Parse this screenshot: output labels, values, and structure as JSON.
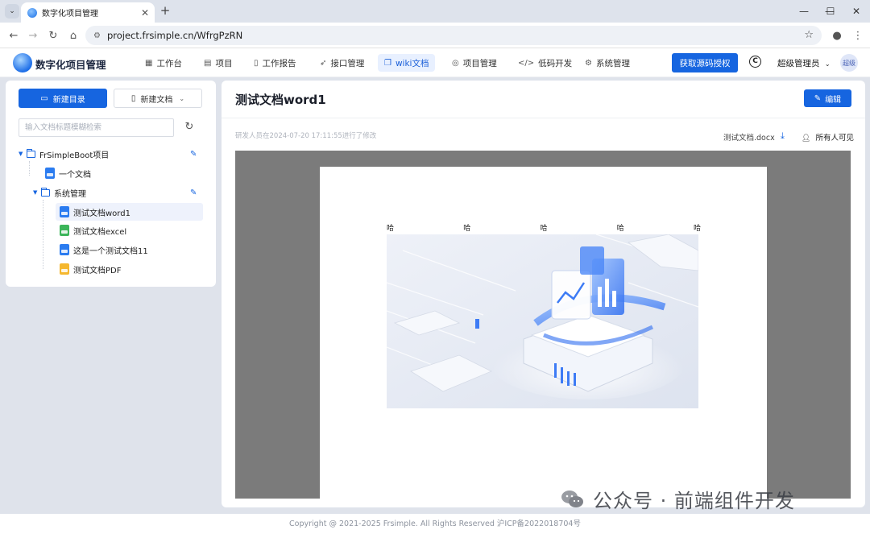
{
  "browser": {
    "tab_title": "数字化项目管理",
    "url": "project.frsimple.cn/WfrgPzRN"
  },
  "app": {
    "brand": "数字化项目管理",
    "menu": [
      {
        "icon": "grid-icon",
        "glyph": "▦",
        "label": "工作台"
      },
      {
        "icon": "list-icon",
        "glyph": "▤",
        "label": "项目"
      },
      {
        "icon": "clipboard-icon",
        "glyph": "▯",
        "label": "工作报告"
      },
      {
        "icon": "rocket-icon",
        "glyph": "➶",
        "label": "接口管理"
      },
      {
        "icon": "copy-icon",
        "glyph": "❐",
        "label": "wiki文档"
      },
      {
        "icon": "target-icon",
        "glyph": "◎",
        "label": "项目管理"
      },
      {
        "icon": "code-icon",
        "glyph": "</>",
        "label": "低码开发"
      },
      {
        "icon": "gear-icon",
        "glyph": "⚙",
        "label": "系统管理"
      }
    ],
    "active_menu": "wiki文档",
    "auth_button": "获取源码授权",
    "copyright_symbol": "C",
    "user": "超级管理员",
    "avatar": "超级",
    "accent_color": "#1665e0"
  },
  "sidebar": {
    "new_dir": "新建目录",
    "new_doc": "新建文档",
    "search_placeholder": "输入文档标题模糊检索",
    "tree": {
      "root": "FrSimpleBoot项目",
      "doc1": "一个文档",
      "folder": "系统管理",
      "items": [
        {
          "label": "测试文档word1",
          "type": "word",
          "color": "#2b7cf0"
        },
        {
          "label": "测试文档excel",
          "type": "excel",
          "color": "#3cb55a"
        },
        {
          "label": "这是一个测试文档11",
          "type": "word",
          "color": "#2b7cf0"
        },
        {
          "label": "测试文档PDF",
          "type": "pdf",
          "color": "#f5b72e"
        }
      ]
    }
  },
  "document": {
    "title": "测试文档word1",
    "edit_button": "编辑",
    "meta": "研发人员在2024-07-20 17:11:55进行了修改",
    "filename": "测试文档.docx",
    "permission": "所有人可见",
    "page_text": [
      "哈",
      "哈",
      "哈",
      "哈",
      "哈"
    ]
  },
  "footer": {
    "text": "Copyright @ 2021-2025 Frsimple. All Rights Reserved 沪ICP备2022018704号"
  },
  "watermark": {
    "text": "公众号 · 前端组件开发"
  }
}
